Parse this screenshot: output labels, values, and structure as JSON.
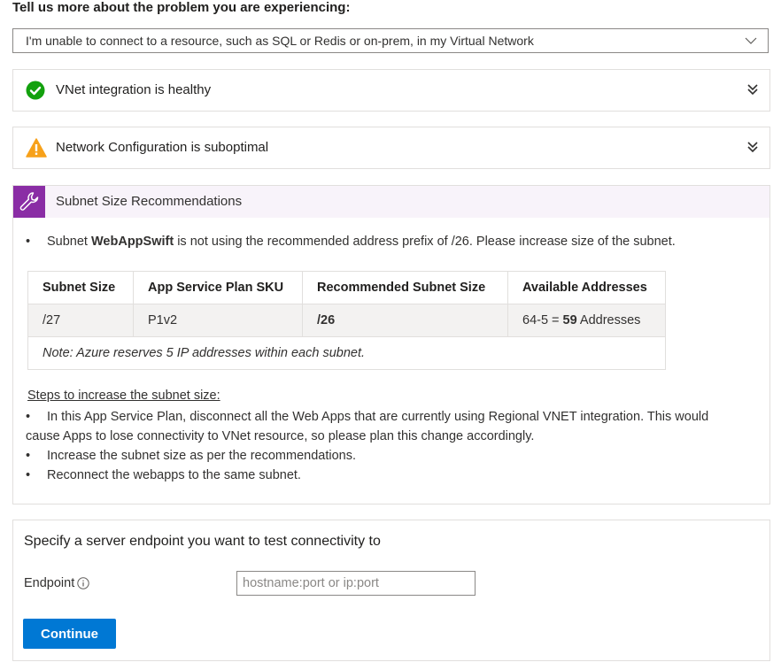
{
  "question": "Tell us more about the problem you are experiencing:",
  "problem_dropdown": {
    "selected": "I'm unable to connect to a resource, such as SQL or Redis or on-prem, in my Virtual Network"
  },
  "checks": [
    {
      "title": "VNet integration is healthy",
      "status": "success",
      "icon": "check-circle-icon",
      "color": "#13a10e"
    },
    {
      "title": "Network Configuration is suboptimal",
      "status": "warning",
      "icon": "warning-triangle-icon",
      "color": "#f7a11a"
    }
  ],
  "subnet_section": {
    "title": "Subnet Size Recommendations",
    "icon": "wrench-icon",
    "accent": "#8a2da5",
    "bullet_prefix": "Subnet ",
    "subnet_name": "WebAppSwift",
    "bullet_suffix": " is not using the recommended address prefix of /26. Please increase size of the subnet.",
    "table": {
      "headers": [
        "Subnet Size",
        "App Service Plan SKU",
        "Recommended Subnet Size",
        "Available Addresses"
      ],
      "row": {
        "subnet_size": "/27",
        "sku": "P1v2",
        "recommended": "/26",
        "available_prefix": "64-5 = ",
        "available_count": "59",
        "available_suffix": " Addresses"
      },
      "note": "Note: Azure reserves 5 IP addresses within each subnet."
    },
    "steps_heading": "Steps to increase the subnet size:",
    "steps": [
      "In this App Service Plan, disconnect all the Web Apps that are currently using Regional VNET integration. This would",
      "cause Apps to lose connectivity to VNet resource, so please plan this change accordingly.",
      "Increase the subnet size as per the recommendations.",
      "Reconnect the webapps to the same subnet."
    ]
  },
  "endpoint": {
    "title": "Specify a server endpoint you want to test connectivity to",
    "label": "Endpoint",
    "placeholder": "hostname:port or ip:port",
    "button": "Continue",
    "button_color": "#0078d4"
  }
}
